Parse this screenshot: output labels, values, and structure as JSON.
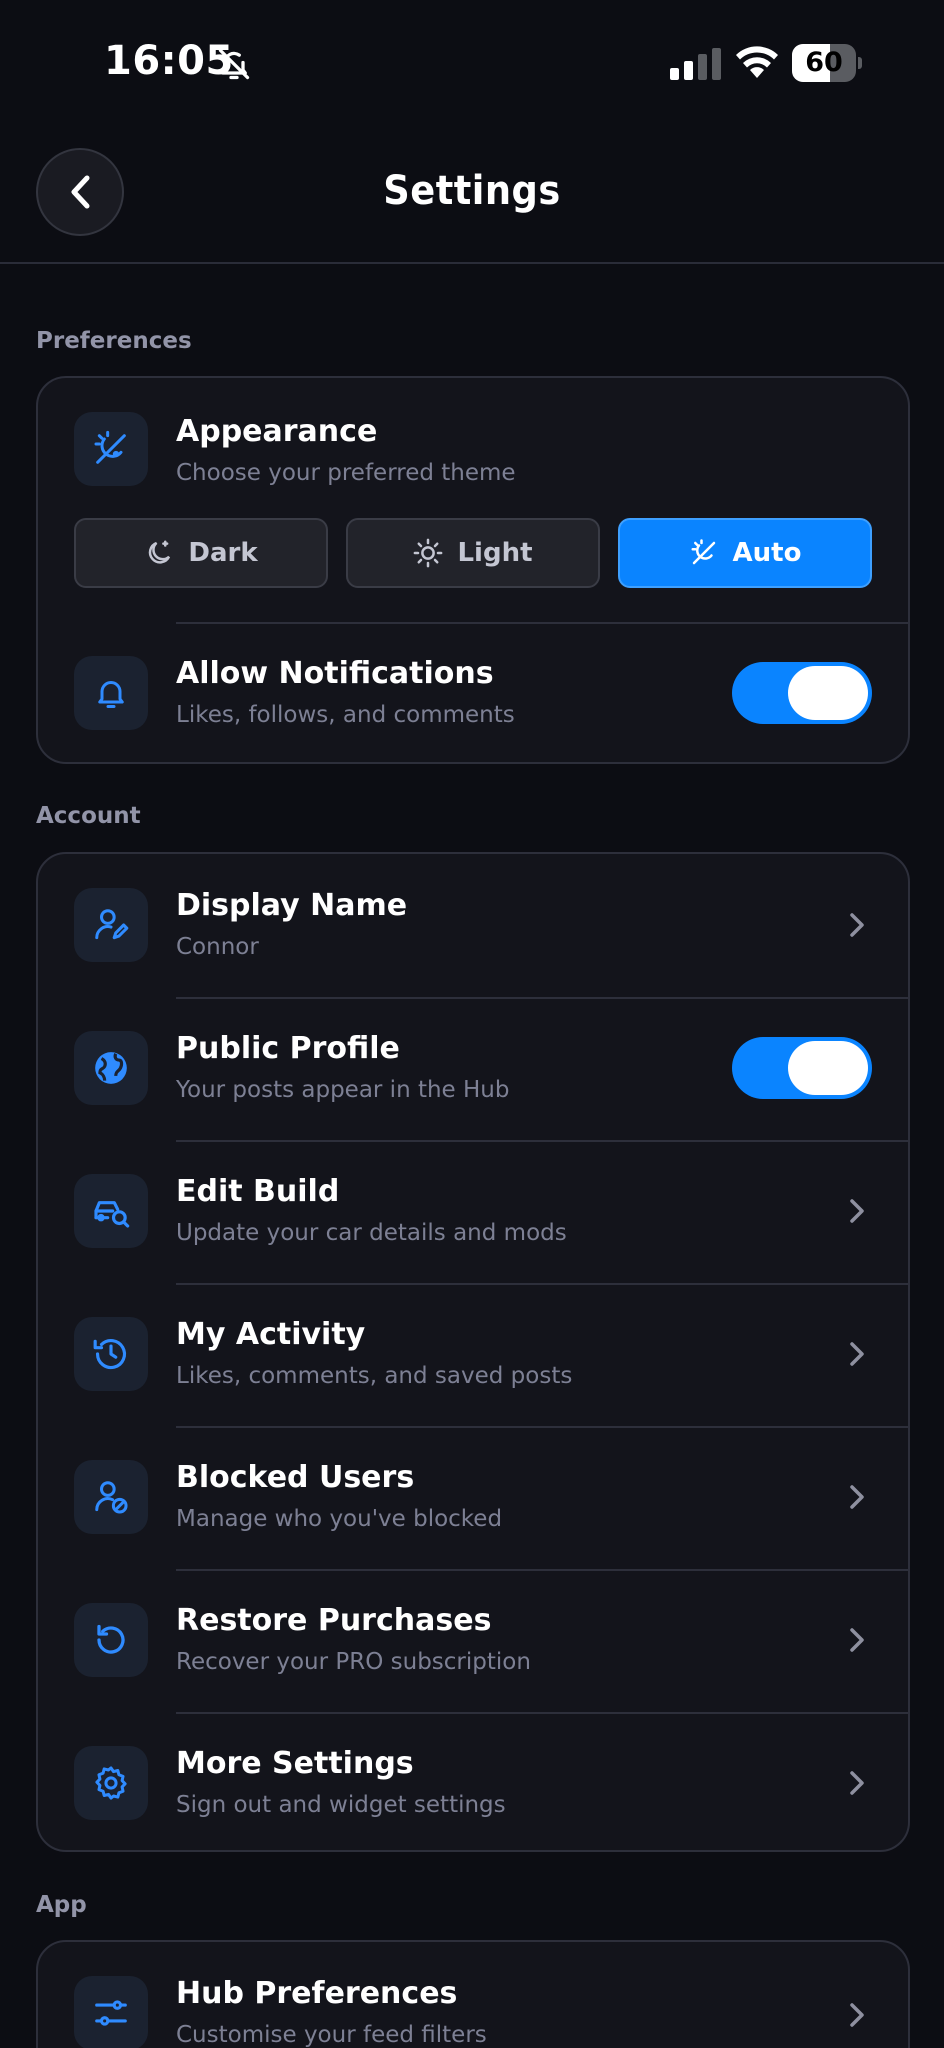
{
  "status_bar": {
    "time": "16:05",
    "battery": "60",
    "battery_level": 0.6
  },
  "nav": {
    "title": "Settings"
  },
  "sections": {
    "preferences": {
      "label": "Preferences",
      "appearance": {
        "title": "Appearance",
        "subtitle": "Choose your preferred theme",
        "options": [
          "Dark",
          "Light",
          "Auto"
        ],
        "selected": "Auto"
      },
      "notifications": {
        "title": "Allow Notifications",
        "subtitle": "Likes, follows, and comments",
        "enabled": true
      }
    },
    "account": {
      "label": "Account",
      "items": [
        {
          "title": "Display Name",
          "subtitle": "Connor",
          "icon": "user-edit-icon",
          "control": "chevron"
        },
        {
          "title": "Public Profile",
          "subtitle": "Your posts appear in the Hub",
          "icon": "globe-icon",
          "control": "toggle",
          "enabled": true
        },
        {
          "title": "Edit Build",
          "subtitle": "Update your car details and mods",
          "icon": "car-search-icon",
          "control": "chevron"
        },
        {
          "title": "My Activity",
          "subtitle": "Likes, comments, and saved posts",
          "icon": "history-icon",
          "control": "chevron"
        },
        {
          "title": "Blocked Users",
          "subtitle": "Manage who you've blocked",
          "icon": "user-blocked-icon",
          "control": "chevron"
        },
        {
          "title": "Restore Purchases",
          "subtitle": "Recover your PRO subscription",
          "icon": "restore-icon",
          "control": "chevron"
        },
        {
          "title": "More Settings",
          "subtitle": "Sign out and widget settings",
          "icon": "gear-icon",
          "control": "chevron"
        }
      ]
    },
    "app": {
      "label": "App",
      "items": [
        {
          "title": "Hub Preferences",
          "subtitle": "Customise your feed filters",
          "icon": "sliders-icon",
          "control": "chevron"
        }
      ]
    }
  },
  "colors": {
    "background": "#0c0d13",
    "card": "#13141b",
    "accent": "#0a84ff",
    "icon_blue": "#2f8bff",
    "subtitle": "#7d8094",
    "section_label": "#9294a8"
  }
}
